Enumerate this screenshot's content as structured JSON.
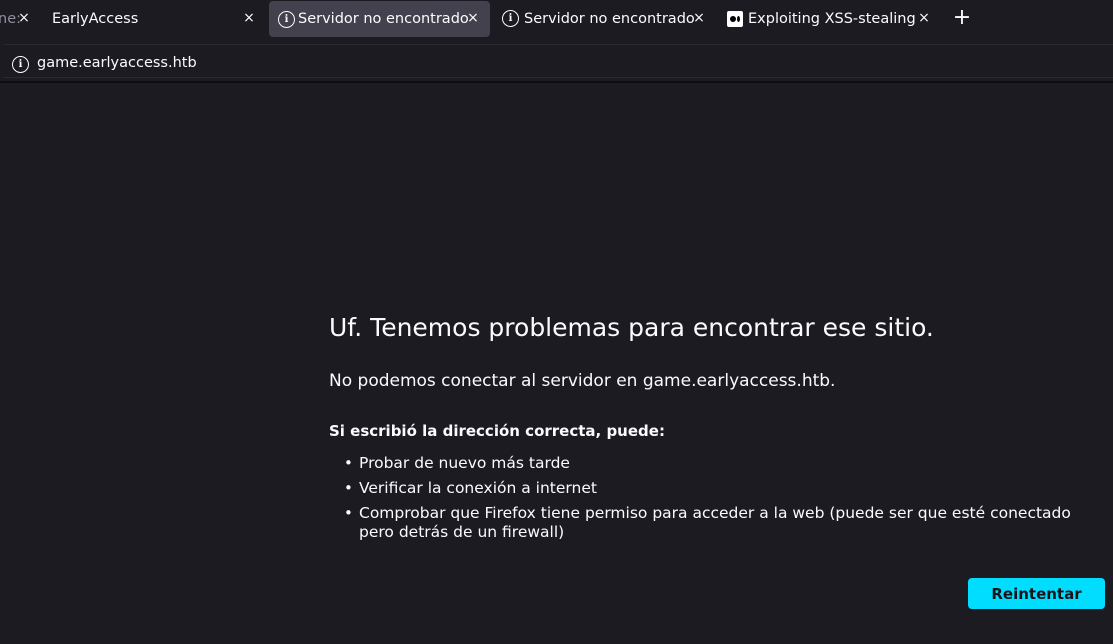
{
  "browser": {
    "tabs": [
      {
        "label": "ne:",
        "icon": "",
        "active": false
      },
      {
        "label": "EarlyAccess",
        "icon": "",
        "active": false
      },
      {
        "label": "Servidor no encontrado",
        "icon": "info-icon",
        "active": true
      },
      {
        "label": "Servidor no encontrado",
        "icon": "info-icon",
        "active": false
      },
      {
        "label": "Exploiting XSS-stealing c",
        "icon": "medium-icon",
        "active": false
      }
    ],
    "close_glyph": "×",
    "new_tab_glyph": "+",
    "url": "game.earlyaccess.htb"
  },
  "error_page": {
    "title": "Uf. Tenemos problemas para encontrar ese sitio.",
    "description": "No podemos conectar al servidor en game.earlyaccess.htb.",
    "suggestions_heading": "Si escribió la dirección correcta, puede:",
    "suggestions": [
      "Probar de nuevo más tarde",
      "Verificar la conexión a internet",
      "Comprobar que Firefox tiene permiso para acceder a la web (puede ser que esté conectado pero detrás de un firewall)"
    ],
    "bullet_glyph": "•",
    "retry_label": "Reintentar"
  },
  "colors": {
    "background": "#1c1b22",
    "active_tab": "#42414d",
    "accent_button": "#00ddff",
    "text": "#fbfbfe"
  }
}
